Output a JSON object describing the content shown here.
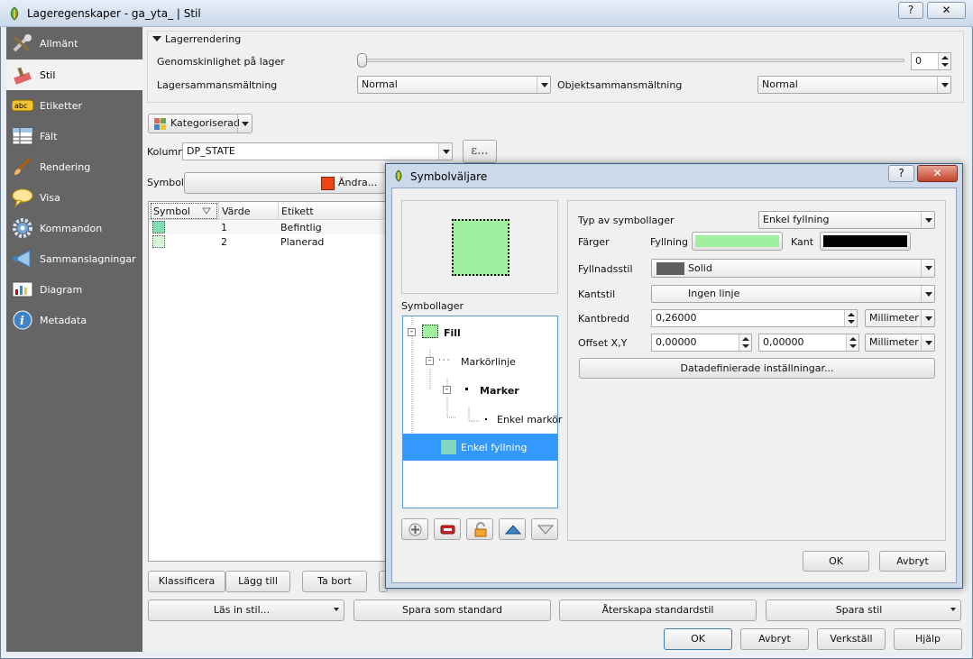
{
  "window": {
    "title": "Lageregenskaper - ga_yta_ | Stil",
    "help": "?",
    "close": "✕"
  },
  "sidebar": {
    "items": [
      {
        "label": "Allmänt",
        "icon": "tools-icon"
      },
      {
        "label": "Stil",
        "icon": "paintbrush-icon"
      },
      {
        "label": "Etiketter",
        "icon": "abc-label-icon"
      },
      {
        "label": "Fält",
        "icon": "table-icon"
      },
      {
        "label": "Rendering",
        "icon": "brush-icon"
      },
      {
        "label": "Visa",
        "icon": "speech-bubble-icon"
      },
      {
        "label": "Kommandon",
        "icon": "gear-icon"
      },
      {
        "label": "Sammanslagningar",
        "icon": "join-icon"
      },
      {
        "label": "Diagram",
        "icon": "chart-icon"
      },
      {
        "label": "Metadata",
        "icon": "info-icon"
      }
    ]
  },
  "layer_rendering": {
    "header": "Lagerrendering",
    "opacity_label": "Genomskinlighet på lager",
    "opacity_value": "0",
    "opacity_fraction": 0,
    "blend_label": "Lagersammansmältning",
    "blend_value": "Normal",
    "feature_blend_label": "Objektsammansmältning",
    "feature_blend_value": "Normal"
  },
  "renderer": {
    "type": "Kategoriserad",
    "column_label": "Kolumn",
    "column_value": "DP_STATE",
    "expr_button": "ε...",
    "symbol_label": "Symbol",
    "change_button": "Ändra..."
  },
  "categories": {
    "headers": [
      "Symbol",
      "Värde",
      "Etikett"
    ],
    "rows": [
      {
        "value": "1",
        "label": "Befintlig"
      },
      {
        "value": "2",
        "label": "Planerad"
      }
    ]
  },
  "bottom": {
    "classify": "Klassificera",
    "add": "Lägg till",
    "remove": "Ta bort",
    "load_style": "Läs in stil...",
    "save_default": "Spara som standard",
    "restore_default": "Återskapa standardstil",
    "save_style": "Spara stil",
    "ok": "OK",
    "cancel": "Avbryt",
    "apply": "Verkställ",
    "help": "Hjälp"
  },
  "symbol_dialog": {
    "title": "Symbolväljare",
    "help": "?",
    "close": "✕",
    "layers_label": "Symbollager",
    "tree": [
      {
        "label": "Fill",
        "bold": true
      },
      {
        "label": "Markörlinje"
      },
      {
        "label": "Marker",
        "bold": true
      },
      {
        "label": "Enkel markör"
      },
      {
        "label": "Enkel fyllning",
        "selected": true
      }
    ],
    "type_label": "Typ av symbollager",
    "type_value": "Enkel fyllning",
    "colors_label": "Färger",
    "fill_label": "Fyllning",
    "border_label": "Kant",
    "fill_style_label": "Fyllnadsstil",
    "fill_style_value": "Solid",
    "border_style_label": "Kantstil",
    "border_style_value": "Ingen linje",
    "border_width_label": "Kantbredd",
    "border_width_value": "0,26000",
    "border_width_unit": "Millimeter",
    "offset_label": "Offset X,Y",
    "offset_x": "0,00000",
    "offset_y": "0,00000",
    "offset_unit": "Millimeter",
    "data_defined": "Datadefinierade inställningar...",
    "ok": "OK",
    "cancel": "Avbryt"
  },
  "colors": {
    "fill": "#a0f0a0",
    "border": "#000000",
    "change_swatch": "#ee4411",
    "category1": "#80e0b0",
    "category2": "#d8f8d8",
    "sidebar_bg": "#656565",
    "selection": "#3399ff"
  }
}
